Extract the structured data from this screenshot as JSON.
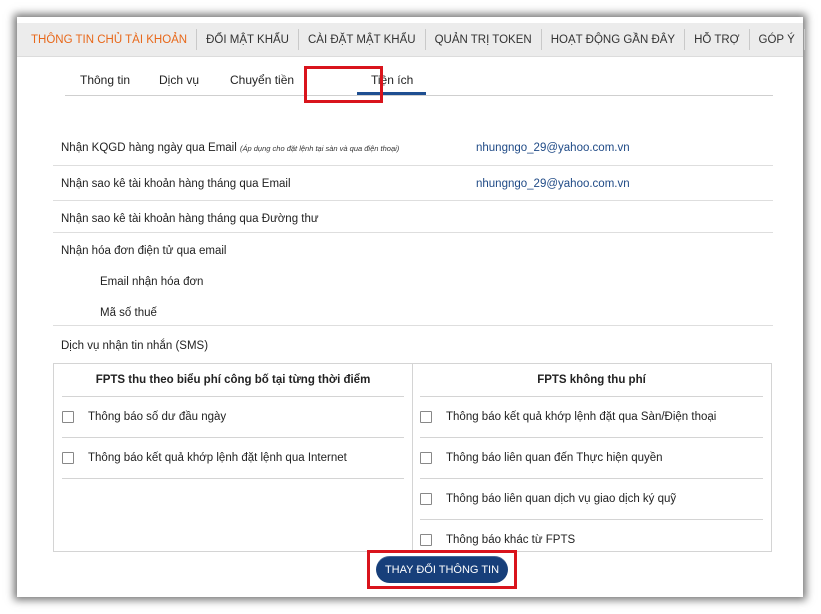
{
  "top_menu": [
    {
      "label": "THÔNG TIN CHỦ TÀI KHOẢN",
      "active": true
    },
    {
      "label": "ĐỔI MẬT KHẨU"
    },
    {
      "label": "CÀI ĐẶT MẬT KHẨU"
    },
    {
      "label": "QUẢN TRỊ TOKEN"
    },
    {
      "label": "HOẠT ĐỘNG GẦN ĐÂY"
    },
    {
      "label": "HỖ TRỢ"
    },
    {
      "label": "GÓP Ý"
    }
  ],
  "sub_tabs": [
    {
      "label": "Thông tin"
    },
    {
      "label": "Dịch vụ"
    },
    {
      "label": "Chuyển tiền"
    },
    {
      "label": "Tiện ích",
      "active": true
    }
  ],
  "rows": {
    "kqgd_label": "Nhận KQGD hàng ngày qua Email",
    "kqgd_note": "(Áp dụng cho đặt lệnh tại sàn và qua điện thoại)",
    "kqgd_value": "nhungngo_29@yahoo.com.vn",
    "saoke_email_label": "Nhận sao kê tài khoản hàng tháng qua Email",
    "saoke_email_value": "nhungngo_29@yahoo.com.vn",
    "saoke_post_label": "Nhận sao kê tài khoản hàng tháng qua Đường thư",
    "invoice_label": "Nhận hóa đơn điện tử qua email",
    "invoice_email_label": "Email nhận hóa đơn",
    "tax_code_label": "Mã số thuế",
    "sms_label": "Dịch vụ nhận tin nhắn (SMS)"
  },
  "sms": {
    "paid_header": "FPTS thu theo biểu phí công bố tại từng thời điểm",
    "free_header": "FPTS không thu phí",
    "paid_options": [
      "Thông báo số dư đầu ngày",
      "Thông báo kết quả khớp lệnh đặt lệnh qua Internet"
    ],
    "free_options": [
      "Thông báo kết quả khớp lệnh đặt qua Sàn/Điện thoại",
      "Thông báo liên quan đến Thực hiện quyền",
      "Thông báo liên quan dịch vụ giao dịch ký quỹ",
      "Thông báo khác từ FPTS"
    ]
  },
  "submit_label": "THAY ĐỔI THÔNG TIN",
  "colors": {
    "accent_orange": "#e8681a",
    "brand_blue": "#173f7a",
    "highlight_red": "#d9141c",
    "link_blue": "#1f4a86"
  }
}
